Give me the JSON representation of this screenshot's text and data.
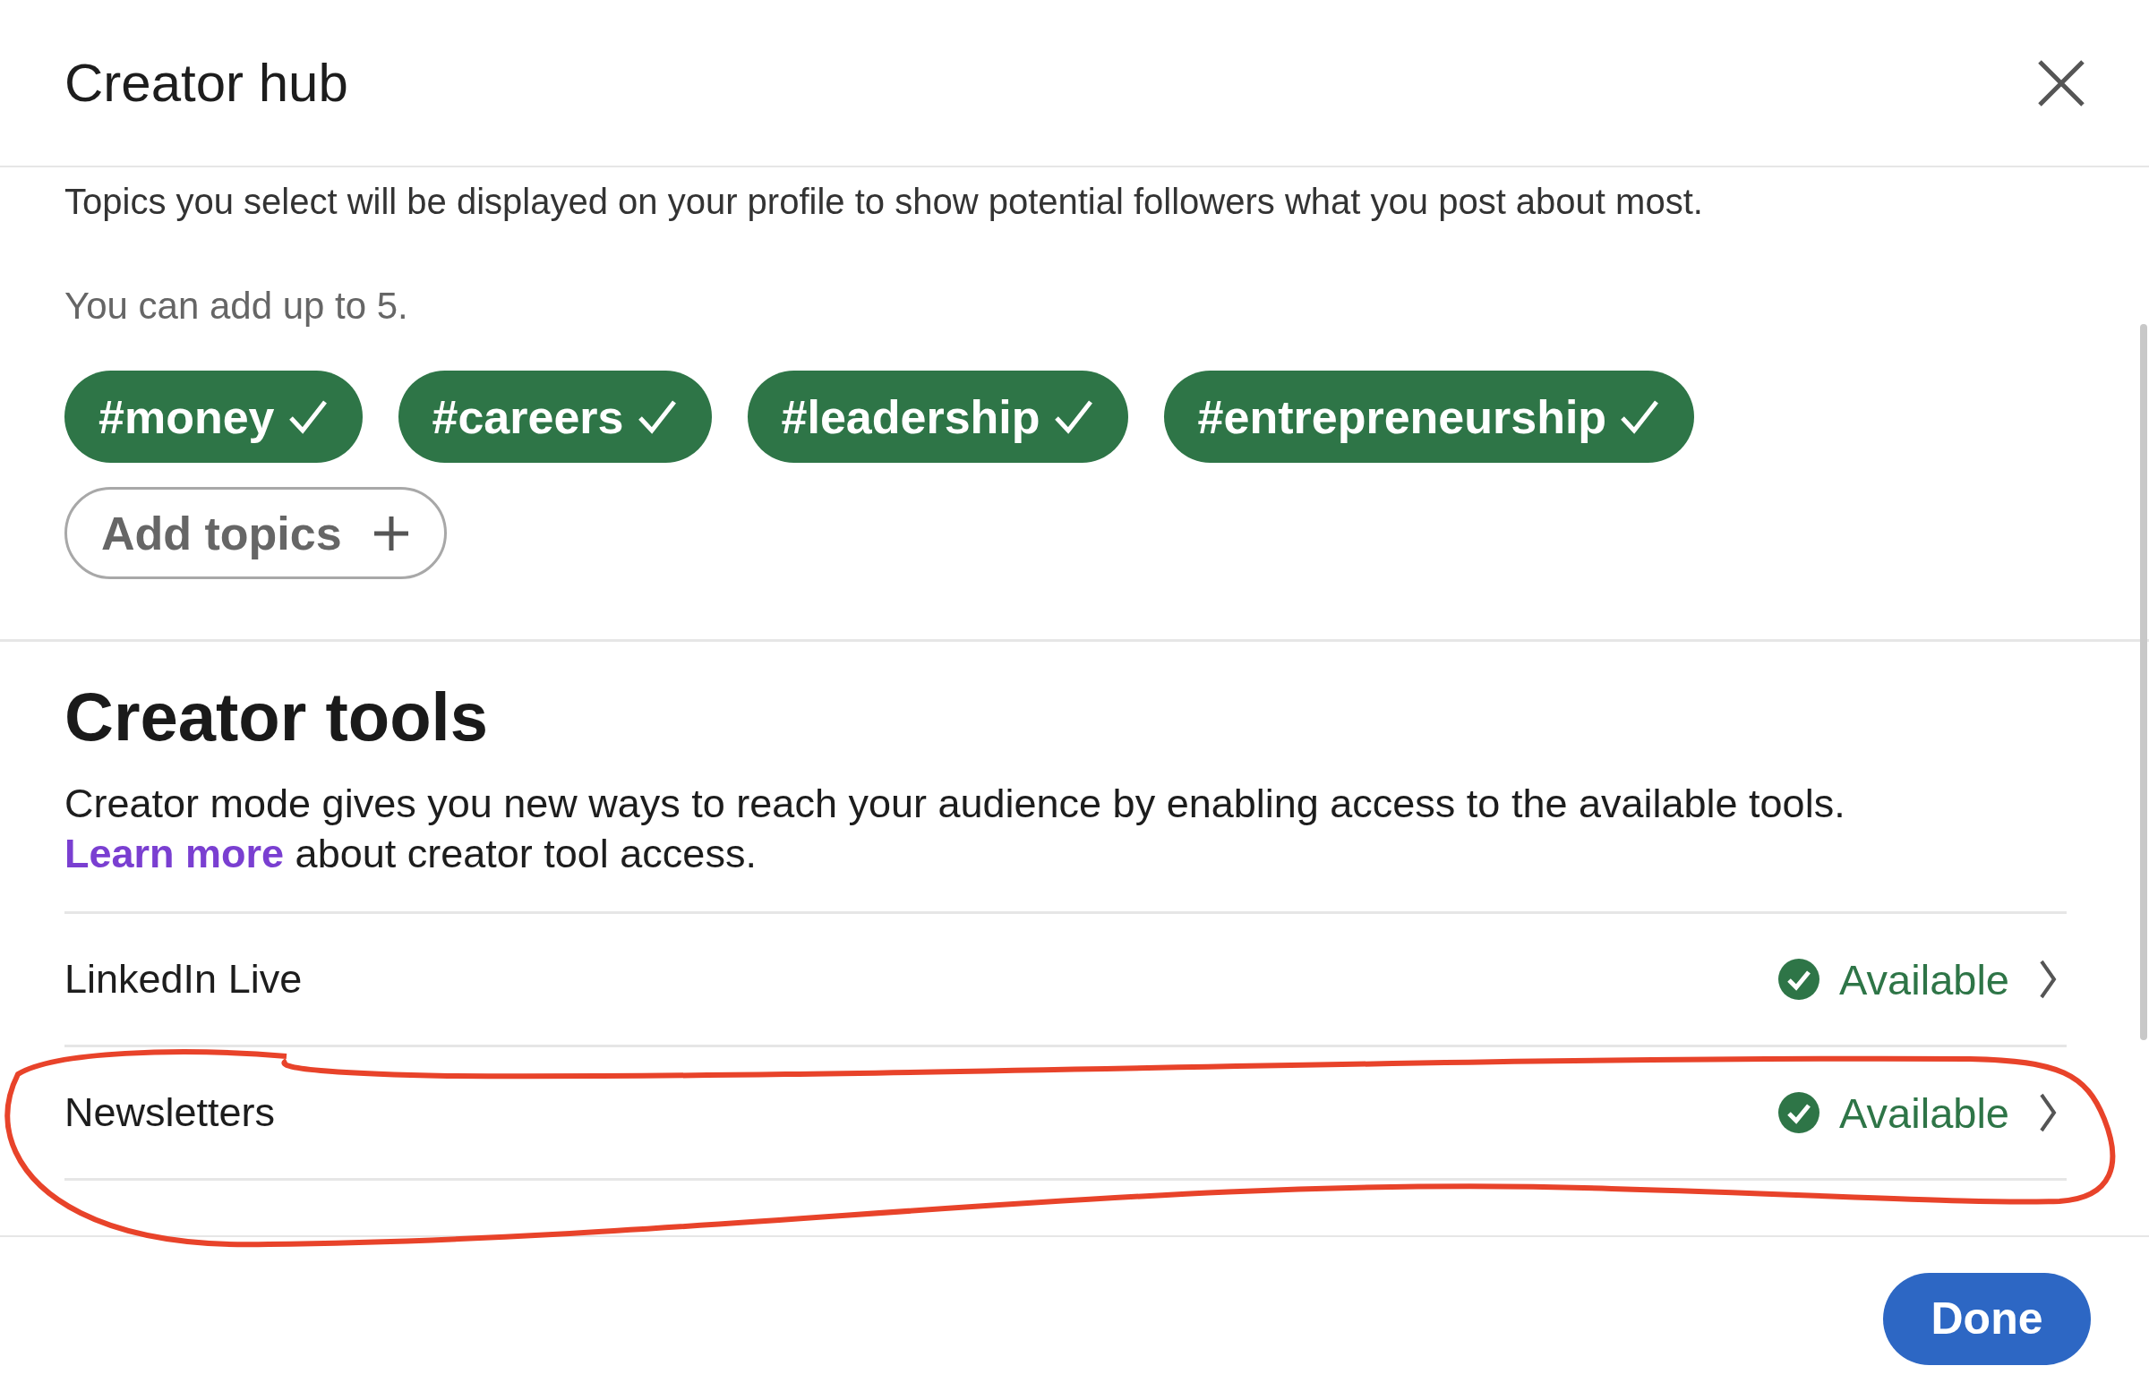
{
  "dialog": {
    "title": "Creator hub"
  },
  "topics_intro": "Topics you select will be displayed on your profile to show potential followers what you post about most.",
  "topics_limit": "You can add up to 5.",
  "topics": [
    {
      "label": "#money",
      "selected": true
    },
    {
      "label": "#careers",
      "selected": true
    },
    {
      "label": "#leadership",
      "selected": true
    },
    {
      "label": "#entrepreneurship",
      "selected": true
    }
  ],
  "add_topics_button": "Add topics",
  "creator_tools": {
    "heading": "Creator tools",
    "description_before": "Creator mode gives you new ways to reach your audience by enabling access to the available tools.",
    "link": "Learn more",
    "description_after": "about creator tool access."
  },
  "tools": [
    {
      "name": "LinkedIn Live",
      "status": "Available",
      "available": true
    },
    {
      "name": "Newsletters",
      "status": "Available",
      "available": true
    }
  ],
  "done_button": "Done"
}
